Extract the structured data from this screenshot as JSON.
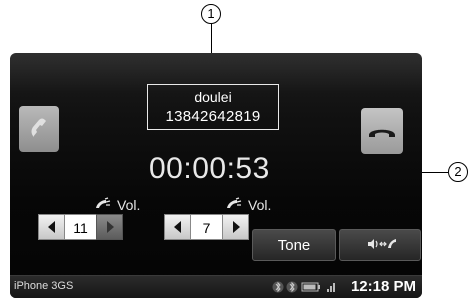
{
  "callouts": {
    "caller_info": "1",
    "call_timer": "2"
  },
  "call": {
    "caller_name": "doulei",
    "caller_number": "13842642819",
    "duration": "00:00:53"
  },
  "volume": {
    "ringtone": {
      "label": "Vol.",
      "value": "11"
    },
    "voice": {
      "label": "Vol.",
      "value": "7"
    }
  },
  "bottom_buttons": {
    "tone_label": "Tone"
  },
  "status_bar": {
    "device_name": "iPhone 3GS",
    "time": "12:18 PM"
  },
  "icons": [
    "phone-handset-icon",
    "hang-up-icon",
    "volume-phone-icon",
    "left-arrow-icon",
    "right-arrow-icon",
    "audio-transfer-icon",
    "bluetooth-icon",
    "battery-icon",
    "signal-icon"
  ],
  "colors": {
    "screen_bg": "#0a0a0a",
    "call_button": "#a0a0a0",
    "text": "#ffffff"
  }
}
